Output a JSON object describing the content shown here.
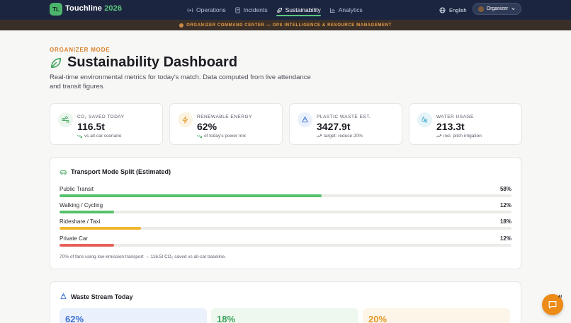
{
  "header": {
    "logo_text": "TL",
    "brand": "Touchline",
    "brand_year": "2026",
    "nav": [
      {
        "label": "Operations",
        "icon": "radio-icon"
      },
      {
        "label": "Incidents",
        "icon": "document-icon"
      },
      {
        "label": "Sustainability",
        "icon": "leaf-icon",
        "active": true
      },
      {
        "label": "Analytics",
        "icon": "bar-chart-icon"
      }
    ],
    "language": "English",
    "role_button": "Organizer"
  },
  "banner": {
    "text": "ORGANIZER COMMAND CENTER — OPS INTELLIGENCE & RESOURCE MANAGEMENT"
  },
  "page": {
    "eyebrow": "ORGANIZER MODE",
    "title": "Sustainability Dashboard",
    "subtitle": "Real-time environmental metrics for today's match. Data computed from live attendance and transit figures."
  },
  "kpis": [
    {
      "label": "CO₂ SAVED TODAY",
      "value": "116.5t",
      "note": "vs all-car scenario",
      "icon": "wind-icon",
      "color": "#3fa35b"
    },
    {
      "label": "RENEWABLE ENERGY",
      "value": "62%",
      "note": "of today's power mix",
      "icon": "lightning-icon",
      "color": "#e29a2a"
    },
    {
      "label": "PLASTIC WASTE EST.",
      "value": "3427.9t",
      "note": "target: reduce 20%",
      "icon": "recycle-icon",
      "color": "#3d6fd1"
    },
    {
      "label": "WATER USAGE",
      "value": "213.3t",
      "note": "incl. pitch irrigation",
      "icon": "droplets-icon",
      "color": "#2aa0c4"
    }
  ],
  "transport": {
    "title": "Transport Mode Split (Estimated)",
    "modes": [
      {
        "label": "Public Transit",
        "pct_text": "58%",
        "pct": 58,
        "color": "#55c26c"
      },
      {
        "label": "Walking / Cycling",
        "pct_text": "12%",
        "pct": 12,
        "color": "#55c26c"
      },
      {
        "label": "Rideshare / Taxi",
        "pct_text": "18%",
        "pct": 18,
        "color": "#f0b72e"
      },
      {
        "label": "Private Car",
        "pct_text": "12%",
        "pct": 12,
        "color": "#e6605a"
      }
    ],
    "note": "70% of fans using low-emission transport → 116.5t CO₂ saved vs all-car baseline."
  },
  "waste": {
    "title": "Waste Stream Today",
    "cards": [
      {
        "value": "62%",
        "color": "#3d6fd1",
        "bg": "#eaf1fd"
      },
      {
        "value": "18%",
        "color": "#3fa35b",
        "bg": "#eef8ef"
      },
      {
        "value": "20%",
        "color": "#e29a2a",
        "bg": "#fdf5e7"
      }
    ]
  },
  "assistant": {
    "badge": "AI"
  }
}
